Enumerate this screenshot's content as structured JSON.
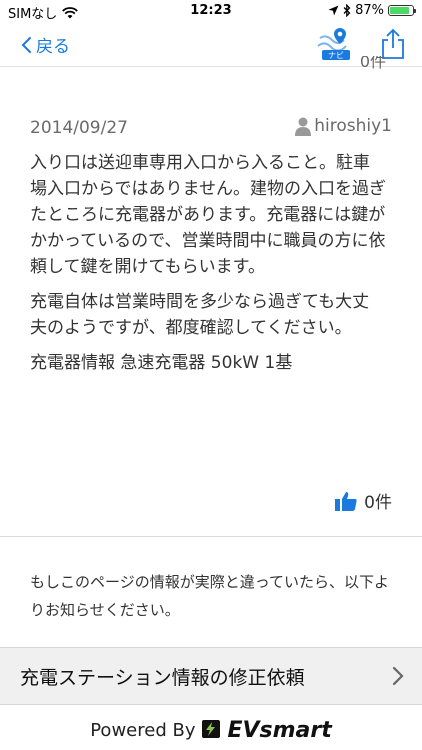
{
  "status": {
    "carrier": "SIMなし",
    "time": "12:23",
    "battery": "87%",
    "battery_level": 0.87
  },
  "nav": {
    "back_label": "戻る",
    "navi_label": "ナビ"
  },
  "partial_top_text": "0件",
  "review": {
    "date": "2014/09/27",
    "user": "hiroshiy1",
    "paragraphs": [
      "入り口は送迎車専用入口から入ること。駐車場入口からではありません。建物の入口を過ぎたところに充電器があります。充電器には鍵がかかっているので、営業時間中に職員の方に依頼して鍵を開けてもらいます。",
      "充電自体は営業時間を多少なら過ぎても大丈夫のようですが、都度確認してください。"
    ],
    "charger_info": "充電器情報 急速充電器 50kW 1基",
    "like_count": "0件"
  },
  "notice": "もしこのページの情報が実際と違っていたら、以下よりお知らせください。",
  "request_label": "充電ステーション情報の修正依頼",
  "footer": {
    "powered_by": "Powered By",
    "brand": "EVsmart"
  },
  "colors": {
    "accent": "#1a7ae0",
    "battery": "#4cd964"
  }
}
